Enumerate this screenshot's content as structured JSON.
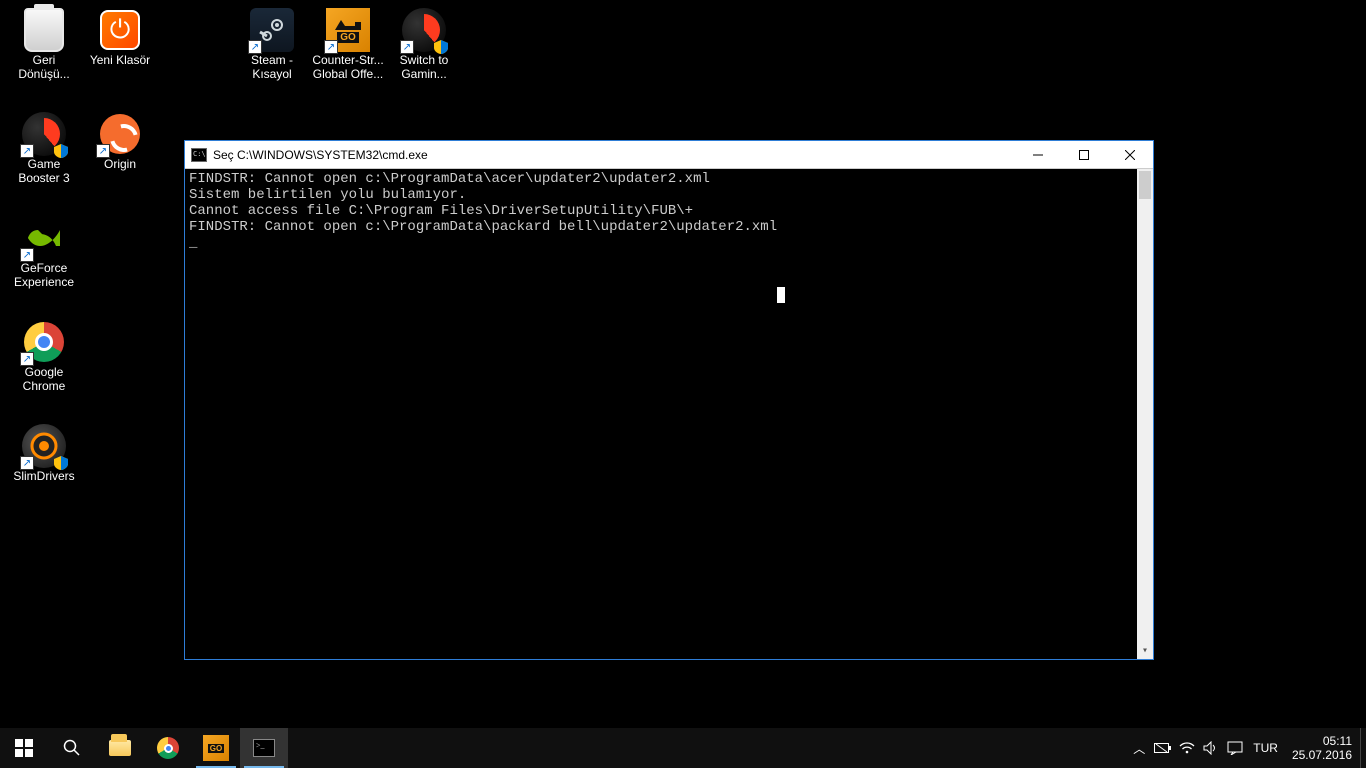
{
  "desktop": {
    "icons": [
      {
        "id": "recycle-bin",
        "label": "Geri\nDönüşü...",
        "col": 0,
        "row": 0,
        "shortcut": false
      },
      {
        "id": "new-folder",
        "label": "Yeni Klasör",
        "col": 1,
        "row": 0,
        "shortcut": false,
        "highlight": true
      },
      {
        "id": "steam",
        "label": "Steam -\nKısayol",
        "col": 3,
        "row": 0,
        "shortcut": true
      },
      {
        "id": "csgo",
        "label": "Counter-Str...\nGlobal Offe...",
        "col": 4,
        "row": 0,
        "shortcut": true
      },
      {
        "id": "switch-gaming",
        "label": "Switch to\nGamin...",
        "col": 5,
        "row": 0,
        "shortcut": true,
        "shield": true
      },
      {
        "id": "game-booster",
        "label": "Game\nBooster 3",
        "col": 0,
        "row": 1,
        "shortcut": true
      },
      {
        "id": "origin",
        "label": "Origin",
        "col": 1,
        "row": 1,
        "shortcut": true
      },
      {
        "id": "geforce",
        "label": "GeForce\nExperience",
        "col": 0,
        "row": 2,
        "shortcut": true
      },
      {
        "id": "chrome",
        "label": "Google\nChrome",
        "col": 0,
        "row": 3,
        "shortcut": true
      },
      {
        "id": "slimdrivers",
        "label": "SlimDrivers",
        "col": 0,
        "row": 4,
        "shortcut": true,
        "shield": true
      }
    ]
  },
  "cmd": {
    "title": "Seç C:\\WINDOWS\\SYSTEM32\\cmd.exe",
    "lines": [
      "FINDSTR: Cannot open c:\\ProgramData\\acer\\updater2\\updater2.xml",
      "Sistem belirtilen yolu bulamıyor.",
      "Cannot access file C:\\Program Files\\DriverSetupUtility\\FUB\\+",
      "FINDSTR: Cannot open c:\\ProgramData\\packard bell\\updater2\\updater2.xml"
    ]
  },
  "taskbar": {
    "tray": {
      "lang": "TUR",
      "time": "05:11",
      "date": "25.07.2016"
    }
  }
}
